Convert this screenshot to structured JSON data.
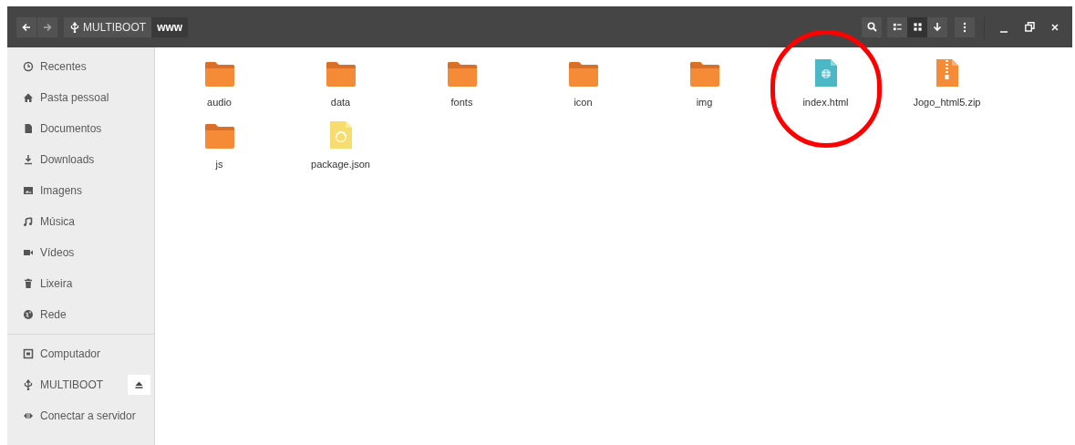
{
  "toolbar": {
    "path": [
      {
        "label": "MULTIBOOT",
        "selected": false
      },
      {
        "label": "www",
        "selected": true
      }
    ],
    "view_buttons": [
      {
        "kind": "list",
        "selected": false
      },
      {
        "kind": "grid",
        "selected": true
      }
    ]
  },
  "sidebar": {
    "sections": [
      {
        "items": [
          {
            "label": "Recentes",
            "ejectable": false
          },
          {
            "label": "Pasta pessoal",
            "ejectable": false
          },
          {
            "label": "Documentos",
            "ejectable": false
          },
          {
            "label": "Downloads",
            "ejectable": false
          },
          {
            "label": "Imagens",
            "ejectable": false
          },
          {
            "label": "Música",
            "ejectable": false
          },
          {
            "label": "Vídeos",
            "ejectable": false
          },
          {
            "label": "Lixeira",
            "ejectable": false
          },
          {
            "label": "Rede",
            "ejectable": false
          }
        ]
      },
      {
        "items": [
          {
            "label": "Computador",
            "ejectable": false
          },
          {
            "label": "MULTIBOOT",
            "ejectable": true
          },
          {
            "label": "Conectar a servidor",
            "ejectable": false
          }
        ]
      }
    ]
  },
  "files": [
    {
      "name": "audio",
      "kind": "folder",
      "circled": false
    },
    {
      "name": "data",
      "kind": "folder",
      "circled": false
    },
    {
      "name": "fonts",
      "kind": "folder",
      "circled": false
    },
    {
      "name": "icon",
      "kind": "folder",
      "circled": false
    },
    {
      "name": "img",
      "kind": "folder",
      "circled": false
    },
    {
      "name": "index.html",
      "kind": "html",
      "circled": true
    },
    {
      "name": "Jogo_html5.zip",
      "kind": "zip",
      "circled": false
    },
    {
      "name": "js",
      "kind": "folder",
      "circled": false
    },
    {
      "name": "package.json",
      "kind": "json",
      "circled": false
    }
  ]
}
